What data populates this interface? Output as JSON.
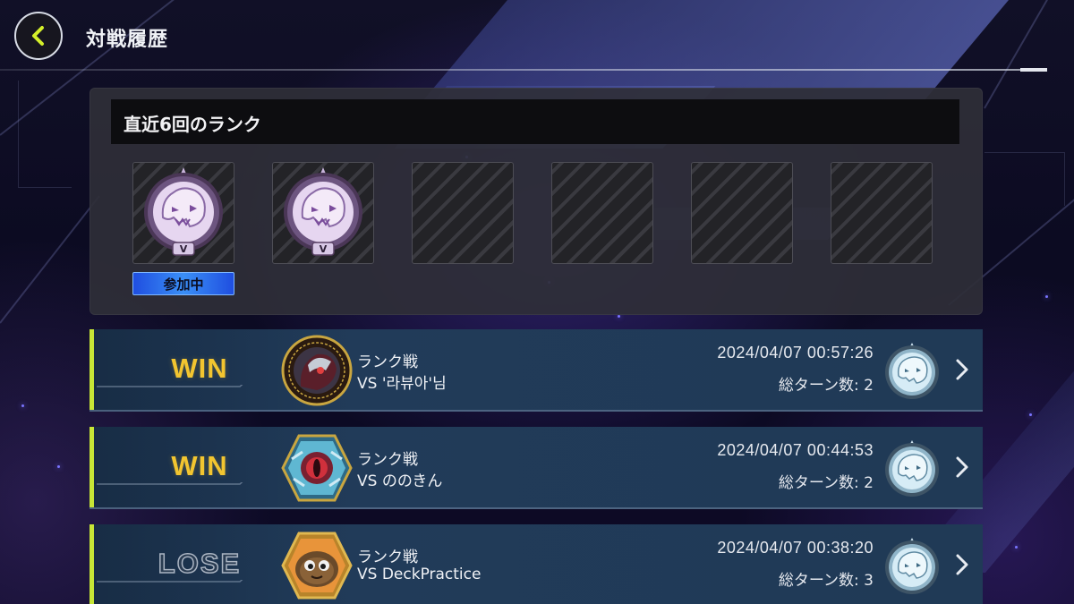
{
  "header": {
    "title": "対戦履歴",
    "back_icon": "chevron-left-icon"
  },
  "rank_history": {
    "title": "直近6回のランク",
    "participating_label": "参加中",
    "slots": [
      {
        "filled": true,
        "badge": "white-wolf-rank-icon",
        "tier": "V"
      },
      {
        "filled": true,
        "badge": "white-wolf-rank-icon",
        "tier": "V"
      },
      {
        "filled": false
      },
      {
        "filled": false
      },
      {
        "filled": false
      },
      {
        "filled": false
      }
    ]
  },
  "duels": [
    {
      "result": "WIN",
      "mode": "ランク戦",
      "opponent": "VS '라뷰아'님",
      "datetime": "2024/04/07 00:57:26",
      "turns": "総ターン数: 2",
      "opponent_icon": "dark-magic-circle-icon",
      "rank_icon": "silver-rank-icon"
    },
    {
      "result": "WIN",
      "mode": "ランク戦",
      "opponent": "VS ののきん",
      "datetime": "2024/04/07 00:44:53",
      "turns": "総ターン数: 2",
      "opponent_icon": "crystal-hexagon-icon",
      "rank_icon": "silver-rank-icon"
    },
    {
      "result": "LOSE",
      "mode": "ランク戦",
      "opponent": "VS DeckPractice",
      "datetime": "2024/04/07 00:38:20",
      "turns": "総ターン数: 3",
      "opponent_icon": "kuriboh-hexagon-icon",
      "rank_icon": "silver-rank-icon"
    }
  ],
  "colors": {
    "win": "#f2c530",
    "accent": "#c7e636",
    "participating": "#2f7df0"
  }
}
